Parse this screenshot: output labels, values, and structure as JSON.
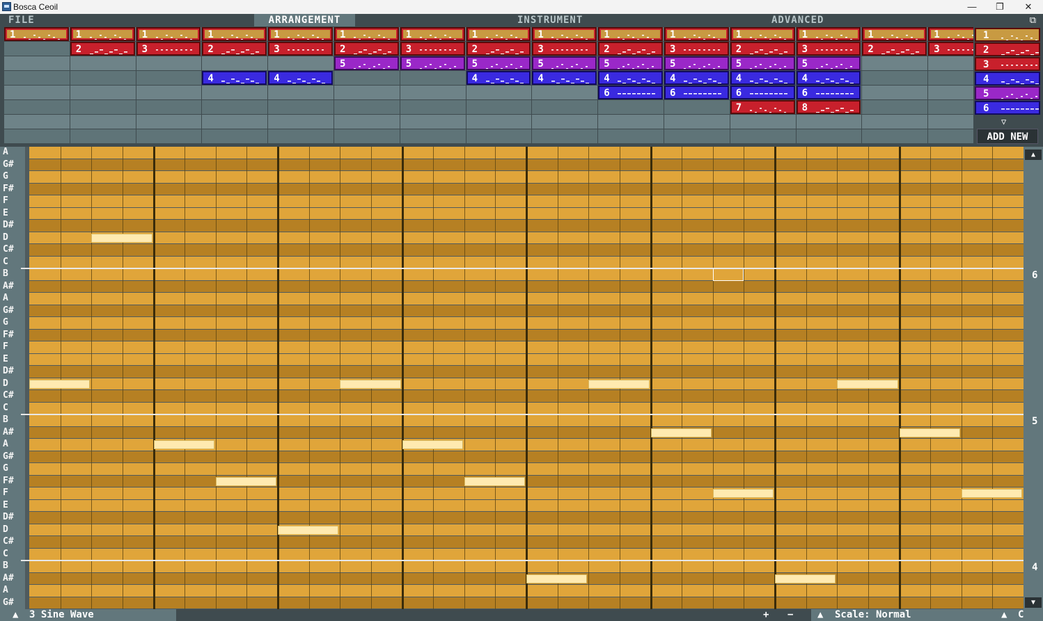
{
  "window": {
    "title": "Bosca Ceoil",
    "minimize": "—",
    "maximize": "❐",
    "close": "✕"
  },
  "menu": {
    "tabs": [
      {
        "label": "FILE",
        "active": false
      },
      {
        "label": "ARRANGEMENT",
        "active": true
      },
      {
        "label": "INSTRUMENT",
        "active": false
      },
      {
        "label": "ADVANCED",
        "active": false
      }
    ],
    "restore_icon": "restore-icon"
  },
  "colors": {
    "instrument_red": "#c8202c",
    "instrument_red_border": "#5a0a0a",
    "instrument_purple": "#9a28c8",
    "instrument_blue": "#3a2ae0",
    "lane_a": "#6e8388",
    "lane_b": "#5f7478",
    "grid_white_row": "#e0a53a",
    "grid_black_row": "#b68023",
    "note": "#ffeab0"
  },
  "arrangement": {
    "lanes": [
      [
        "1",
        "1",
        "1",
        "1",
        "1",
        "1",
        "1",
        "1",
        "1",
        "1",
        "1",
        "1",
        "1",
        "1",
        "1"
      ],
      [
        "",
        "2",
        "3",
        "2",
        "3",
        "2",
        "3",
        "2",
        "3",
        "2",
        "3",
        "2",
        "3",
        "2",
        "3"
      ],
      [
        "",
        "",
        "",
        "",
        "",
        "5",
        "5",
        "5",
        "5",
        "5",
        "5",
        "5",
        "5",
        "",
        ""
      ],
      [
        "",
        "",
        "",
        "4",
        "4",
        "",
        "",
        "4",
        "4",
        "4",
        "4",
        "4",
        "4",
        "",
        ""
      ],
      [
        "",
        "",
        "",
        "",
        "",
        "",
        "",
        "",
        "",
        "6",
        "6",
        "6",
        "6",
        "",
        ""
      ],
      [
        "",
        "",
        "",
        "",
        "",
        "",
        "",
        "",
        "",
        "",
        "",
        "7",
        "8",
        "",
        ""
      ],
      [
        "",
        "",
        "",
        "",
        "",
        "",
        "",
        "",
        "",
        "",
        "",
        "",
        "",
        "",
        ""
      ],
      [
        "",
        "",
        "",
        "",
        "",
        "",
        "",
        "",
        "",
        "",
        "",
        "",
        "",
        "",
        ""
      ]
    ]
  },
  "palette": {
    "items": [
      "1",
      "2",
      "3",
      "4",
      "5",
      "6"
    ],
    "add_new": "ADD NEW",
    "more_icon": "chevron-down-icon"
  },
  "piano_roll": {
    "key_labels": [
      "A",
      "G#",
      "G",
      "F#",
      "F",
      "E",
      "D#",
      "D",
      "C#",
      "C",
      "B",
      "A#",
      "A",
      "G#",
      "G",
      "F#",
      "F",
      "E",
      "D#",
      "D",
      "C#",
      "C",
      "B",
      "A#",
      "A",
      "G#",
      "G",
      "F#",
      "F",
      "E",
      "D#",
      "D",
      "C#",
      "C",
      "B",
      "A#",
      "A",
      "G#"
    ],
    "octave_labels": [
      {
        "label": "6",
        "row": 10
      },
      {
        "label": "5",
        "row": 22
      },
      {
        "label": "4",
        "row": 34
      }
    ],
    "steps": 32,
    "notes": [
      {
        "row": 19,
        "step": 0,
        "length": 2
      },
      {
        "row": 7,
        "step": 2,
        "length": 2
      },
      {
        "row": 24,
        "step": 4,
        "length": 2
      },
      {
        "row": 27,
        "step": 6,
        "length": 2
      },
      {
        "row": 31,
        "step": 8,
        "length": 2
      },
      {
        "row": 19,
        "step": 10,
        "length": 2
      },
      {
        "row": 24,
        "step": 12,
        "length": 2
      },
      {
        "row": 27,
        "step": 14,
        "length": 2
      },
      {
        "row": 35,
        "step": 16,
        "length": 2
      },
      {
        "row": 19,
        "step": 18,
        "length": 2
      },
      {
        "row": 23,
        "step": 20,
        "length": 2
      },
      {
        "row": 28,
        "step": 22,
        "length": 2
      },
      {
        "row": 35,
        "step": 24,
        "length": 2
      },
      {
        "row": 19,
        "step": 26,
        "length": 2
      },
      {
        "row": 23,
        "step": 28,
        "length": 2
      },
      {
        "row": 28,
        "step": 30,
        "length": 2
      }
    ],
    "cursor": {
      "row": 10,
      "step": 22
    }
  },
  "bottom": {
    "instrument_label": "3  Sine Wave",
    "zoom_in": "+",
    "zoom_out": "−",
    "scale_label": "Scale: Normal",
    "key_label": "C"
  }
}
